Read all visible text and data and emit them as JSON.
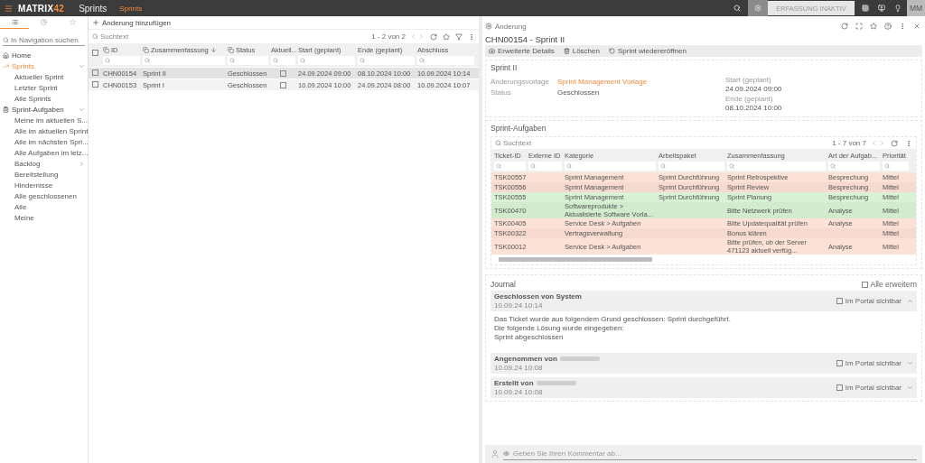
{
  "topbar": {
    "logo_main": "MATRIX",
    "logo_accent": "42",
    "app_title": "Sprints",
    "breadcrumb": "Sprints",
    "status_text": "ERFASSUNG INAKTIV",
    "avatar": "MM"
  },
  "sidebar": {
    "tabs": [
      {
        "kind": "list",
        "selected": true
      },
      {
        "kind": "history",
        "selected": false
      },
      {
        "kind": "favorites",
        "selected": false
      }
    ],
    "search_placeholder": "In Navigation suchen",
    "items": [
      {
        "label": "Home",
        "kind": "home",
        "selected": false
      },
      {
        "label": "Sprints",
        "kind": "trend",
        "selected": true,
        "expanded": true,
        "children": [
          {
            "label": "Aktueller Sprint"
          },
          {
            "label": "Letzter Sprint"
          },
          {
            "label": "Alle Sprints"
          }
        ]
      },
      {
        "label": "Sprint-Aufgaben",
        "kind": "clipboard",
        "selected": false,
        "expanded": true,
        "children": [
          {
            "label": "Meine im aktuellen S..."
          },
          {
            "label": "Alle im aktuellen Sprint"
          },
          {
            "label": "Alle im nächsten Spri..."
          },
          {
            "label": "Alle Aufgaben im letz..."
          },
          {
            "label": "Backlog",
            "submenu": true
          },
          {
            "label": "Bereitstellung"
          },
          {
            "label": "Hindernisse"
          },
          {
            "label": "Alle geschlossenen"
          },
          {
            "label": "Alle"
          },
          {
            "label": "Meine"
          }
        ]
      }
    ]
  },
  "list": {
    "add_label": "Änderung hinzufügen",
    "search_placeholder": "Suchtext",
    "pager": "1 - 2 von 2",
    "select_all_checked": false,
    "columns": [
      {
        "label": "ID",
        "kind": "copy"
      },
      {
        "label": "Zusammenfassung",
        "kind": "copy_sort"
      },
      {
        "label": "Status",
        "kind": "copy"
      },
      {
        "label": "Aktuell...",
        "kind": "plain"
      },
      {
        "label": "Start (geplant)",
        "kind": "plain"
      },
      {
        "label": "Ende (geplant)",
        "kind": "plain"
      },
      {
        "label": "Abschluss",
        "kind": "plain"
      }
    ],
    "rows": [
      {
        "selected": true,
        "current": false,
        "cells": [
          "CHN00154",
          "Sprint II",
          "Geschlossen",
          "",
          "24.09.2024 09:00",
          "08.10.2024 10:00",
          "10.09.2024 10:14"
        ]
      },
      {
        "selected": false,
        "current": false,
        "cells": [
          "CHN00153",
          "Sprint I",
          "Geschlossen",
          "",
          "10.09.2024 10:00",
          "24.09.2024 08:00",
          "10.09.2024 10:07"
        ]
      }
    ]
  },
  "detail": {
    "type_label": "Änderung",
    "title": "CHN00154 - Sprint II",
    "actions": [
      {
        "label": "Erweiterte Details",
        "kind": "camera"
      },
      {
        "label": "Löschen",
        "kind": "trash"
      },
      {
        "label": "Sprint wiedereröffnen",
        "kind": "reopen"
      }
    ],
    "card": {
      "title": "Sprint II",
      "left_fields": [
        {
          "label": "Änderungsvorlage",
          "value": "Sprint Management Vorlage",
          "kind": "link"
        },
        {
          "label": "Status",
          "value": "Geschlossen",
          "kind": "text"
        }
      ],
      "right_fields": [
        {
          "label": "Start (geplant)",
          "value": "24.09.2024 09:00"
        },
        {
          "label": "Ende (geplant)",
          "value": "08.10.2024 10:00"
        }
      ]
    },
    "tasks": {
      "title": "Sprint-Aufgaben",
      "search_placeholder": "Suchtext",
      "pager": "1 - 7 von 7",
      "columns": [
        "Ticket-ID",
        "Externe ID",
        "Kategorie",
        "Arbeitspaket",
        "Zusammenfassung",
        "Art der Aufgab...",
        "Priorität"
      ],
      "rows": [
        {
          "color": "#fbe1d6",
          "cells": [
            "TSK00557",
            "",
            "Sprint Management",
            "Sprint Durchführung",
            "Sprint Retrospektive",
            "Besprechung",
            "Mittel"
          ]
        },
        {
          "color": "#f6d9cf",
          "cells": [
            "TSK00556",
            "",
            "Sprint Management",
            "Sprint Durchführung",
            "Sprint Review",
            "Besprechung",
            "Mittel"
          ]
        },
        {
          "color": "#d9f1d4",
          "cells": [
            "TSK00555",
            "",
            "Sprint Management",
            "Sprint Durchführung",
            "Sprint Planung",
            "Besprechung",
            "Mittel"
          ]
        },
        {
          "color": "#d2ebcc",
          "cells": [
            "TSK00470",
            "",
            "Softwareprodukte > Aktualisierte Software Vorla...",
            "",
            "Bitte Netzwerk prüfen",
            "Analyse",
            "Mittel"
          ]
        },
        {
          "color": "#fbe1d6",
          "cells": [
            "TSK00405",
            "",
            "Service Desk > Aufgaben",
            "",
            "Bitte Updatequalität prüfen",
            "Analyse",
            "Mittel"
          ]
        },
        {
          "color": "#f6d9cf",
          "cells": [
            "TSK00322",
            "",
            "Vertragsverwaltung",
            "",
            "Bonus klären",
            "",
            "Mittel"
          ]
        },
        {
          "color": "#fbe1d6",
          "cells": [
            "TSK00012",
            "",
            "Service Desk > Aufgaben",
            "",
            "Bitte prüfen, ob der Server 471123 aktuell verfüg...",
            "Analyse",
            "Mittel"
          ]
        }
      ]
    },
    "journal": {
      "title": "Journal",
      "expand_all": {
        "label": "Alle erweitern",
        "checked": false
      },
      "entries": [
        {
          "title": "Geschlossen von System",
          "redacted": false,
          "time": "10.09.24 10:14",
          "portal": {
            "label": "Im Portal sichtbar",
            "checked": false
          },
          "expanded": true,
          "body": [
            "Das Ticket wurde aus folgendem Grund geschlossen: Sprint durchgeführt.",
            "Die folgende Lösung wurde eingegeben:",
            "Sprint abgeschlossen"
          ]
        },
        {
          "title": "Angenommen von",
          "redacted": true,
          "time": "10.09.24 10:08",
          "portal": {
            "label": "Im Portal sichtbar",
            "checked": false
          },
          "expanded": false
        },
        {
          "title": "Erstellt von",
          "redacted": true,
          "time": "10.09.24 10:08",
          "portal": {
            "label": "Im Portal sichtbar",
            "checked": false
          },
          "expanded": false
        }
      ]
    },
    "comment_placeholder": "Geben Sie Ihren Kommentar ab..."
  }
}
